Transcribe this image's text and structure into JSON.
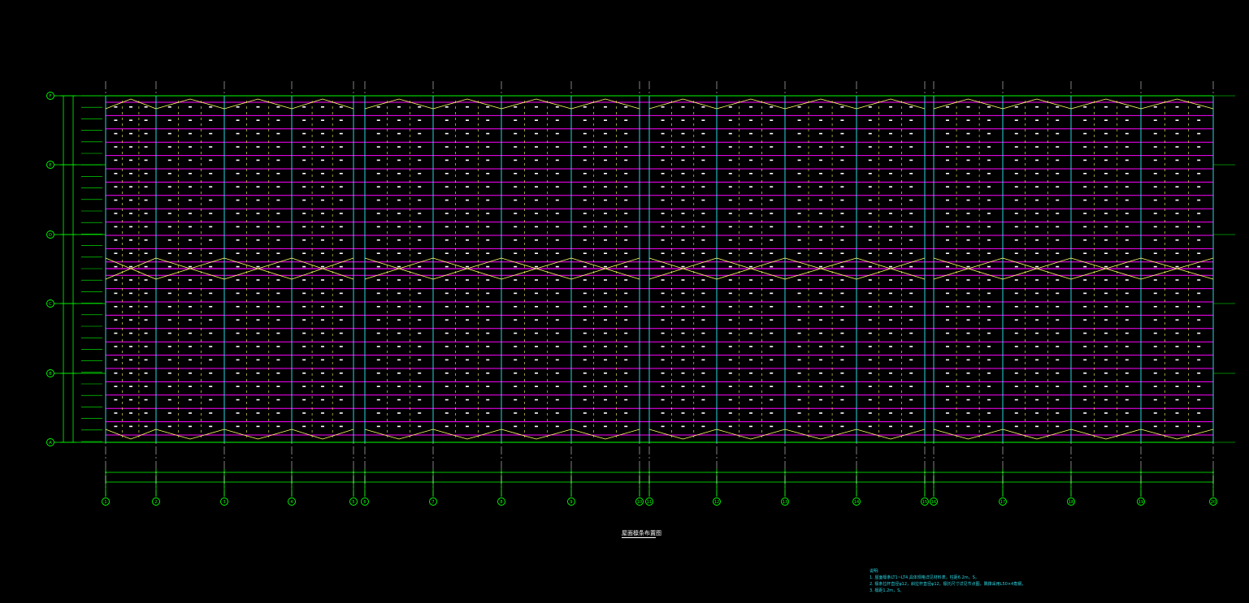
{
  "drawing": {
    "title": "屋面檩条布置图",
    "colors": {
      "background": "#000000",
      "grid_axis": "#00ff00",
      "purlin": "#ff00ff",
      "rafter": "#2ad4e0",
      "brace": "#ffff66",
      "tag": "#ffffff",
      "notes": "#2ad4e0"
    },
    "row_axes": [
      "F",
      "E",
      "D",
      "C",
      "B",
      "A"
    ],
    "column_axes": [
      "1",
      "2",
      "3",
      "4",
      "5",
      "6",
      "7",
      "8",
      "9",
      "10",
      "11",
      "12",
      "13",
      "14",
      "15",
      "16",
      "17",
      "18",
      "19",
      "20"
    ]
  },
  "notes": {
    "heading": "说明:",
    "lines": [
      "1. 屋面檩条LT1~LT4.具体规格详见材料表，柱距6.2m，S，",
      "2. 檩条拉杆直径φ12，斜拉杆直径φ12，檩托尺寸详见节点图，隅撑采用L50×4角钢，",
      "3. 檩距1.2m，S。"
    ]
  }
}
